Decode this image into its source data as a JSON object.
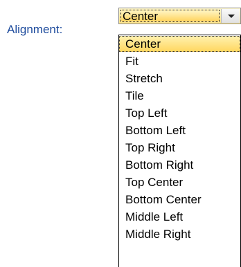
{
  "form": {
    "alignment_label": "Alignment:"
  },
  "combo": {
    "value": "Center"
  },
  "dropdown": {
    "options": [
      "Center",
      "Fit",
      "Stretch",
      "Tile",
      "Top Left",
      "Bottom Left",
      "Top Right",
      "Bottom Right",
      "Top Center",
      "Bottom Center",
      "Middle Left",
      "Middle Right"
    ],
    "selected": "Center"
  },
  "colors": {
    "label_text": "#1c4a9c",
    "highlight": "#ffd65e"
  }
}
